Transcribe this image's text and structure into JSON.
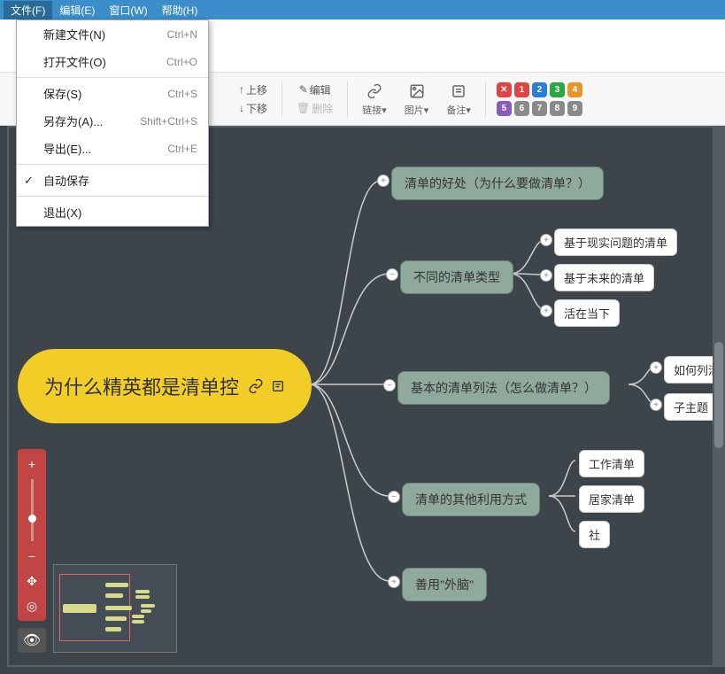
{
  "menubar": {
    "file": "文件(F)",
    "edit": "编辑(E)",
    "window": "窗口(W)",
    "help": "帮助(H)"
  },
  "dropdown": {
    "new": {
      "label": "新建文件(N)",
      "shortcut": "Ctrl+N"
    },
    "open": {
      "label": "打开文件(O)",
      "shortcut": "Ctrl+O"
    },
    "save": {
      "label": "保存(S)",
      "shortcut": "Ctrl+S"
    },
    "saveas": {
      "label": "另存为(A)...",
      "shortcut": "Shift+Ctrl+S"
    },
    "export": {
      "label": "导出(E)...",
      "shortcut": "Ctrl+E"
    },
    "autosave": {
      "label": "自动保存"
    },
    "exit": {
      "label": "退出(X)"
    }
  },
  "toolbar": {
    "up": "上移",
    "down": "下移",
    "edit": "编辑",
    "delete": "删除",
    "link": "链接",
    "image": "图片",
    "note": "备注",
    "badges_row1": [
      "✕",
      "1",
      "2",
      "3",
      "4"
    ],
    "badges_row2": [
      "5",
      "6",
      "7",
      "8",
      "9"
    ],
    "badge_colors_row1": [
      "#d44",
      "#d44",
      "#2b7ed6",
      "#2aa644",
      "#e69626"
    ],
    "badge_colors_row2": [
      "#8a5bbd",
      "#8a8a8a",
      "#8a8a8a",
      "#8a8a8a",
      "#8a8a8a"
    ]
  },
  "mindmap": {
    "main": "为什么精英都是清单控",
    "n1": "清单的好处（为什么要做清单？）",
    "n2": "不同的清单类型",
    "n2a": "基于现实问题的清单",
    "n2b": "基于未来的清单",
    "n2c": "活在当下",
    "n3": "基本的清单列法（怎么做清单？）",
    "n3a": "如何列清单",
    "n3b": "子主题",
    "n4": "清单的其他利用方式",
    "n4a": "工作清单",
    "n4b": "居家清单",
    "n4c": "社",
    "n5": "善用\"外脑\""
  },
  "icons": {
    "link": "link-icon",
    "note": "note-icon",
    "arrow_up": "↑",
    "arrow_down": "↓",
    "pencil": "✎",
    "trash": "🗑",
    "dropdown": "▾",
    "eye": "👁",
    "plus": "+",
    "minus": "−",
    "move": "✥",
    "target": "◎"
  }
}
